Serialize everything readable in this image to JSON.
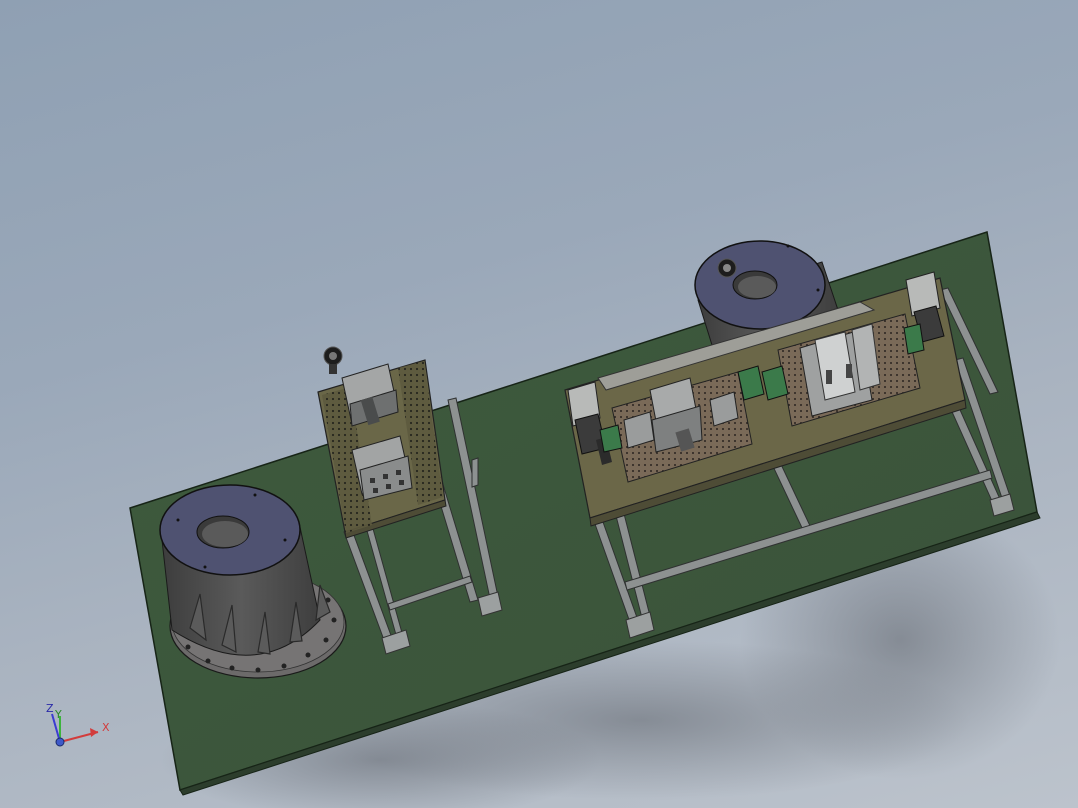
{
  "viewport": {
    "background_top": "#8fa0b3",
    "background_bottom": "#bcc3cc"
  },
  "colors": {
    "base_plate": "#3f5a3e",
    "base_plate_edge": "#1b2a1b",
    "table_top": "#6b6748",
    "frame": "#8d9191",
    "cylinder": "#4f5050",
    "cylinder_top": "#505370",
    "fixture": "#9ea0a0"
  },
  "triad": {
    "x_label": "X",
    "y_label": "Y",
    "z_label": "Z",
    "x_color": "#d23c3c",
    "y_color": "#3cb43c",
    "z_color": "#3c3cd2",
    "icon": "coordinate-triad-icon"
  }
}
